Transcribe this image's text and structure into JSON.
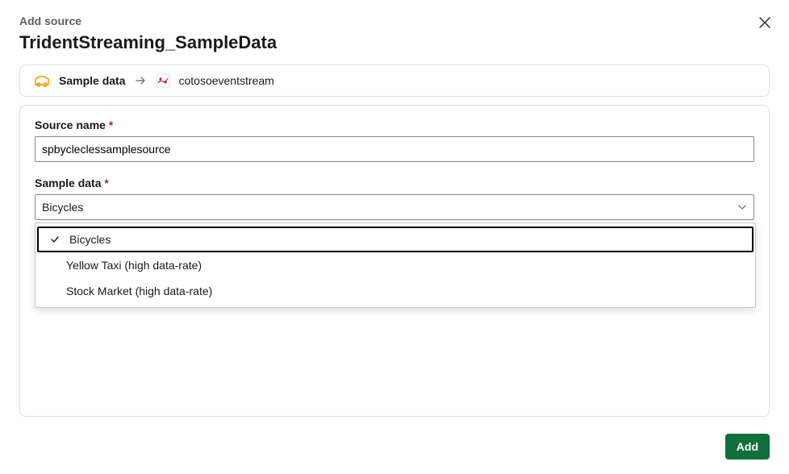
{
  "dialog": {
    "subtitle": "Add source",
    "title": "TridentStreaming_SampleData"
  },
  "breadcrumb": {
    "source_label": "Sample data",
    "target_label": "cotosoeventstream"
  },
  "form": {
    "source_name_label": "Source name",
    "source_name_value": "spbycleclessamplesource",
    "sample_data_label": "Sample data",
    "sample_data_selected": "Bicycles",
    "options": [
      {
        "label": "Bicycles",
        "selected": true
      },
      {
        "label": "Yellow Taxi (high data-rate)",
        "selected": false
      },
      {
        "label": "Stock Market (high data-rate)",
        "selected": false
      }
    ]
  },
  "footer": {
    "add_label": "Add"
  },
  "required_marker": "*"
}
